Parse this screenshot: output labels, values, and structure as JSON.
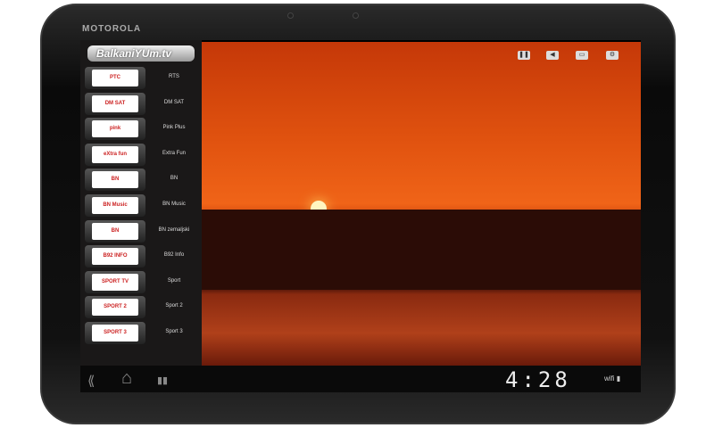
{
  "device": {
    "brand": "MOTOROLA"
  },
  "app": {
    "logo": "BalkaniYUm.tv"
  },
  "channels": [
    {
      "label": "RTS",
      "logo": "РТС"
    },
    {
      "label": "DM SAT",
      "logo": "DM SAT"
    },
    {
      "label": "Pink Plus",
      "logo": "pink"
    },
    {
      "label": "Extra Fun",
      "logo": "eXtra fun"
    },
    {
      "label": "BN",
      "logo": "BN"
    },
    {
      "label": "BN Music",
      "logo": "BN Music"
    },
    {
      "label": "BN zemaljski",
      "logo": "BN"
    },
    {
      "label": "B92 Info",
      "logo": "B92 INFO"
    },
    {
      "label": "Sport",
      "logo": "SPORT TV"
    },
    {
      "label": "Sport 2",
      "logo": "SPORT 2"
    },
    {
      "label": "Sport 3",
      "logo": "SPORT 3"
    }
  ],
  "controls": {
    "pause": "❚❚",
    "volume": "◀",
    "screen": "▭",
    "settings": "⚙"
  },
  "nav": {
    "back": "⟪",
    "home": "⌂",
    "recent": "▮▮"
  },
  "status": {
    "time": "4:28",
    "icons": "wifi ▮"
  }
}
